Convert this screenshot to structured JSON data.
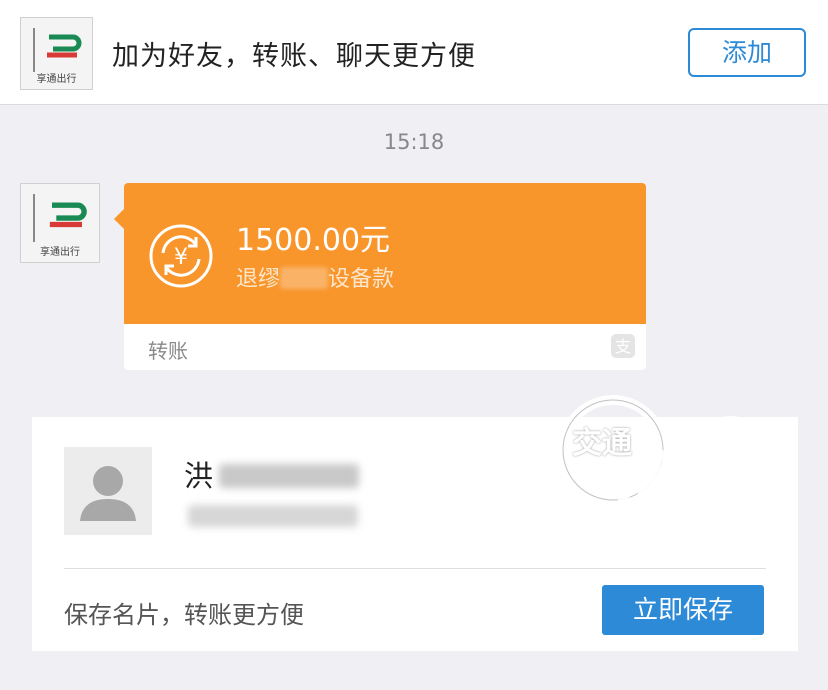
{
  "header": {
    "logo_text": "享通出行",
    "prompt_text": "加为好友，转账、聊天更方便",
    "add_button_label": "添加"
  },
  "chat": {
    "timestamp": "15:18",
    "sender_logo_text": "享通出行",
    "transfer": {
      "amount": "1500.00元",
      "description_prefix": "退缪",
      "description_suffix": "设备款",
      "label": "转账",
      "color": "#f8962c",
      "icon": "yuan-transfer-icon"
    }
  },
  "contact_card": {
    "name_visible": "洪",
    "save_prompt": "保存名片，转账更方便",
    "save_button_label": "立即保存"
  },
  "watermark": {
    "text": "交通"
  },
  "colors": {
    "accent_blue": "#2d8ad6",
    "transfer_orange": "#f8962c",
    "background": "#efeff4"
  }
}
